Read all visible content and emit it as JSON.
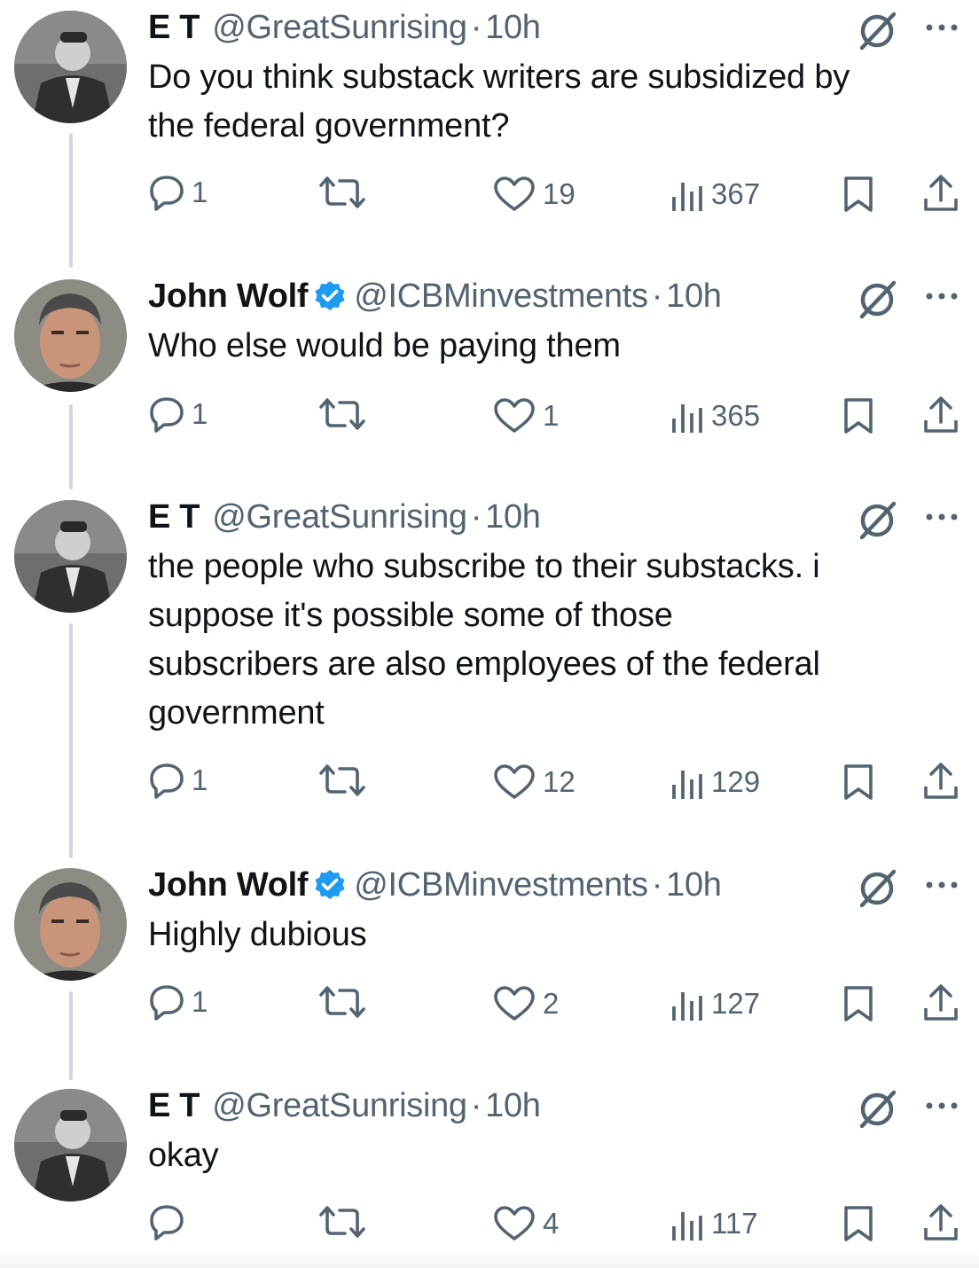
{
  "colors": {
    "text": "#0f1419",
    "muted": "#536471",
    "verified": "#1d9bf0",
    "thread_line": "#cfd9de"
  },
  "tweets": [
    {
      "author": "E T",
      "handle": "@GreatSunrising",
      "separator": "·",
      "time": "10h",
      "verified": false,
      "avatar": "bw-suited-man-avatar",
      "lines": [
        "Do you think substack writers are subsidized by",
        "the federal government?"
      ],
      "replies": "1",
      "retweets": "",
      "likes": "19",
      "views": "367"
    },
    {
      "author": "John Wolf",
      "handle": "@ICBMinvestments",
      "separator": "·",
      "time": "10h",
      "verified": true,
      "avatar": "color-portrait-man-avatar",
      "lines": [
        "Who else would be paying them"
      ],
      "replies": "1",
      "retweets": "",
      "likes": "1",
      "views": "365"
    },
    {
      "author": "E T",
      "handle": "@GreatSunrising",
      "separator": "·",
      "time": "10h",
      "verified": false,
      "avatar": "bw-suited-man-avatar",
      "lines": [
        "the people who subscribe to their substacks. i",
        "suppose it's possible some of those",
        "subscribers are also employees of the federal",
        "government"
      ],
      "replies": "1",
      "retweets": "",
      "likes": "12",
      "views": "129"
    },
    {
      "author": "John Wolf",
      "handle": "@ICBMinvestments",
      "separator": "·",
      "time": "10h",
      "verified": true,
      "avatar": "color-portrait-man-avatar",
      "lines": [
        "Highly dubious"
      ],
      "replies": "1",
      "retweets": "",
      "likes": "2",
      "views": "127"
    },
    {
      "author": "E T",
      "handle": "@GreatSunrising",
      "separator": "·",
      "time": "10h",
      "verified": false,
      "avatar": "bw-suited-man-avatar",
      "lines": [
        "okay"
      ],
      "replies": "",
      "retweets": "",
      "likes": "4",
      "views": "117"
    }
  ],
  "icons": [
    "reply-icon",
    "retweet-icon",
    "like-icon",
    "views-icon",
    "bookmark-icon",
    "share-icon",
    "grok-icon",
    "more-icon",
    "verified-badge-icon"
  ]
}
